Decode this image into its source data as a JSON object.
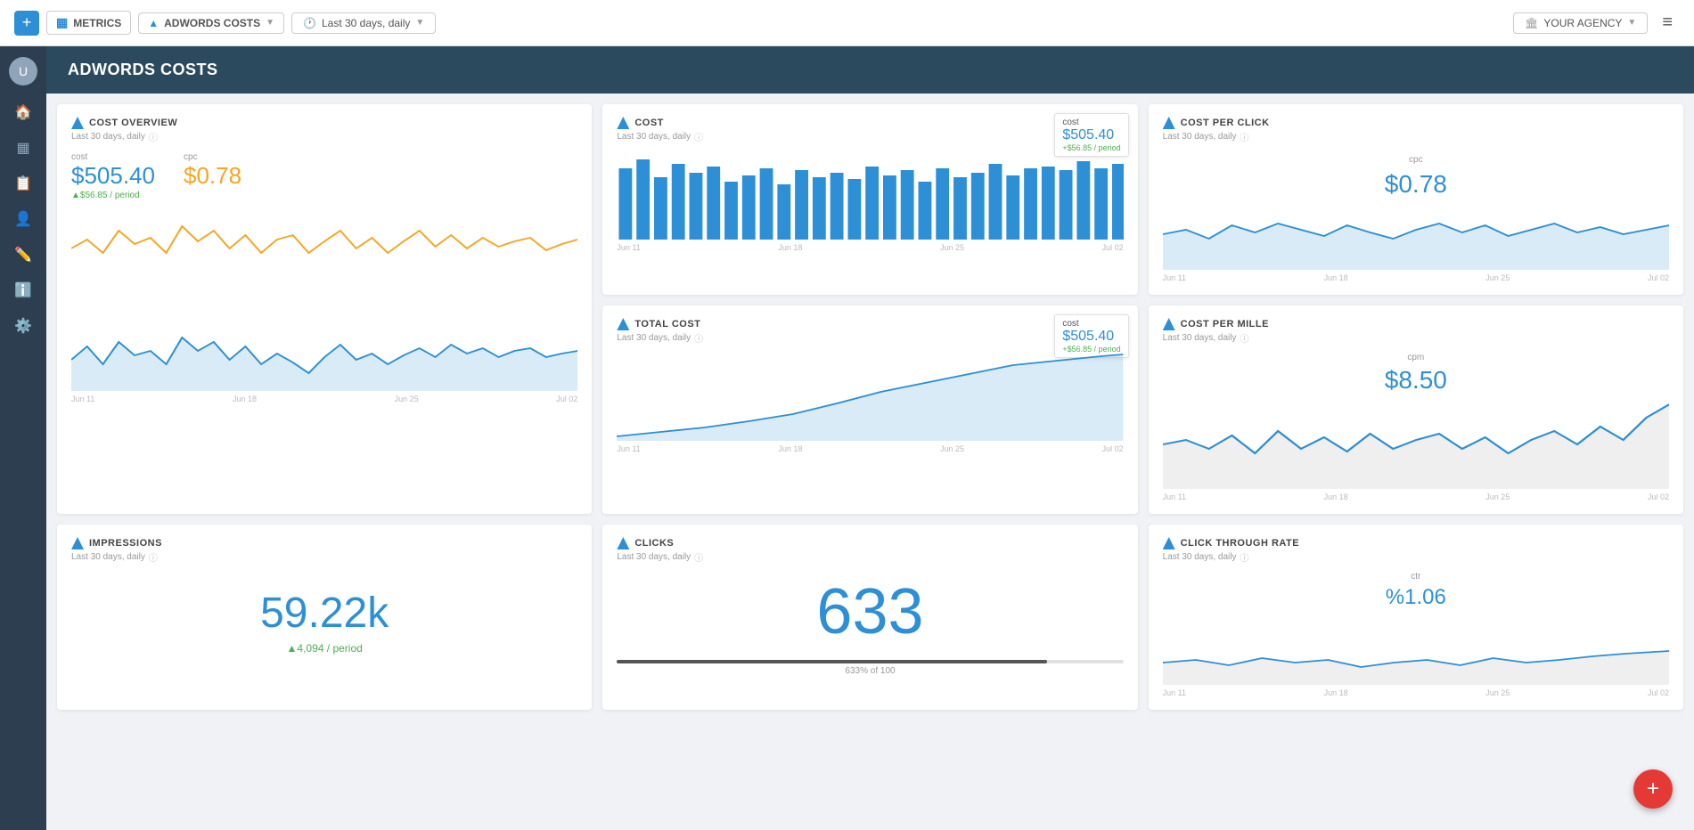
{
  "topbar": {
    "add_label": "+",
    "metrics_label": "METRICS",
    "adwords_label": "ADWORDS COSTS",
    "date_label": "Last 30 days, daily",
    "agency_label": "YOUR AGENCY",
    "menu_icon": "≡"
  },
  "sidebar": {
    "icons": [
      "🏠",
      "▦",
      "📋",
      "👤",
      "✏️",
      "ℹ️",
      "⚙️"
    ]
  },
  "page": {
    "title": "ADWORDS COSTS"
  },
  "cost_overview": {
    "title": "COST OVERVIEW",
    "subtitle": "Last 30 days, daily",
    "cost_label": "cost",
    "cpc_label": "cpc",
    "cost_value": "$505.40",
    "cpc_value": "$0.78",
    "cost_change": "▲$56.85 / period",
    "x_labels": [
      "Jun 11",
      "Jun 18",
      "Jun 25",
      "Jul 02"
    ]
  },
  "cost": {
    "title": "COST",
    "subtitle": "Last 30 days, daily",
    "tooltip_label": "cost",
    "tooltip_value": "$505.40",
    "tooltip_change": "+$56.85 / period",
    "x_labels": [
      "Jun 11",
      "Jun 18",
      "Jun 25",
      "Jul 02"
    ]
  },
  "total_cost": {
    "title": "TOTAL COST",
    "subtitle": "Last 30 days, daily",
    "tooltip_label": "cost",
    "tooltip_value": "$505.40",
    "tooltip_change": "+$56.85 / period",
    "x_labels": [
      "Jun 11",
      "Jun 18",
      "Jun 25",
      "Jul 02"
    ]
  },
  "cost_per_click": {
    "title": "COST PER CLICK",
    "subtitle": "Last 30 days, daily",
    "cpc_label": "cpc",
    "cpc_value": "$0.78",
    "x_labels": [
      "Jun 11",
      "Jun 18",
      "Jun 25",
      "Jul 02"
    ]
  },
  "cost_per_mille": {
    "title": "COST PER MILLE",
    "subtitle": "Last 30 days, daily",
    "cpm_label": "cpm",
    "cpm_value": "$8.50",
    "x_labels": [
      "Jun 11",
      "Jun 18",
      "Jun 25",
      "Jul 02"
    ]
  },
  "impressions": {
    "title": "IMPRESSIONS",
    "subtitle": "Last 30 days, daily",
    "value": "59.22k",
    "change": "▲4,094 / period"
  },
  "clicks": {
    "title": "CLICKS",
    "subtitle": "Last 30 days, daily",
    "value": "633",
    "progress_label": "633% of 100"
  },
  "ctr": {
    "title": "CLICK THROUGH RATE",
    "subtitle": "Last 30 days, daily",
    "ctr_label": "ctr",
    "ctr_value": "%1.06",
    "x_labels": [
      "Jun 11",
      "Jun 18",
      "Jun 25",
      "Jul 02"
    ]
  }
}
